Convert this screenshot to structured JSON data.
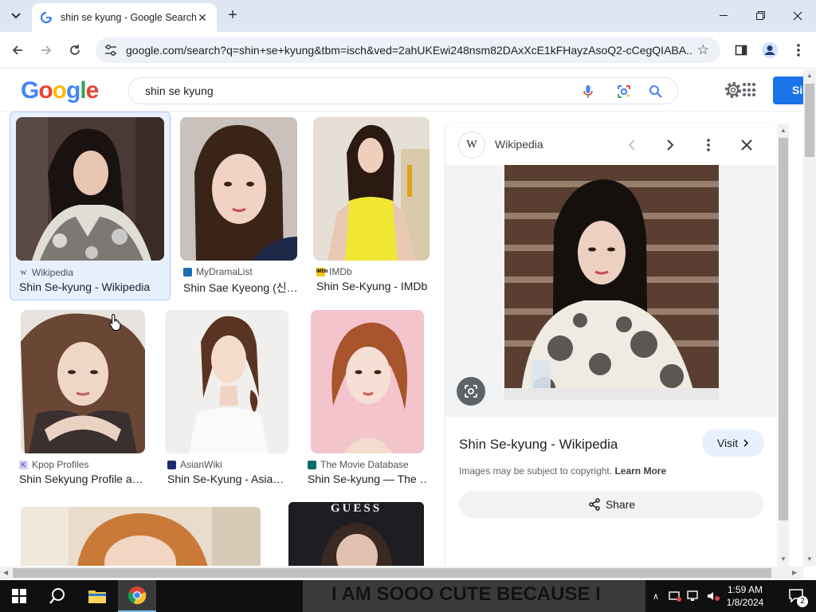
{
  "browser": {
    "tab_title": "shin se kyung - Google Search",
    "url": "google.com/search?q=shin+se+kyung&tbm=isch&ved=2ahUKEwi248nsm82DAxXcE1kFHayzAsoQ2-cCegQIABA..."
  },
  "google": {
    "logo": "Google",
    "query": "shin se kyung",
    "signin_label": "Si"
  },
  "results": [
    {
      "source": "Wikipedia",
      "caption": "Shin Se-kyung - Wikipedia"
    },
    {
      "source": "MyDramaList",
      "caption": "Shin Sae Kyeong (신…"
    },
    {
      "source": "IMDb",
      "caption": "Shin Se-Kyung - IMDb"
    },
    {
      "source": "Kpop Profiles",
      "caption": "Shin Sekyung Profile a…"
    },
    {
      "source": "AsianWiki",
      "caption": "Shin Se-Kyung - Asia…"
    },
    {
      "source": "The Movie Database",
      "caption": "Shin Se-kyung — The …"
    },
    {
      "source": "",
      "caption": ""
    },
    {
      "source": "",
      "caption": "GUESS"
    }
  ],
  "panel": {
    "source": "Wikipedia",
    "wiki_logo": "W",
    "title": "Shin Se-kyung - Wikipedia",
    "visit_label": "Visit",
    "copyright_text": "Images may be subject to copyright.",
    "learn_more": "Learn More",
    "share_label": "Share"
  },
  "taskbar": {
    "wallpaper_text": "I AM SOOO CUTE BECAUSE I",
    "time": "1:59 AM",
    "date": "1/8/2024",
    "notifications": "2"
  }
}
